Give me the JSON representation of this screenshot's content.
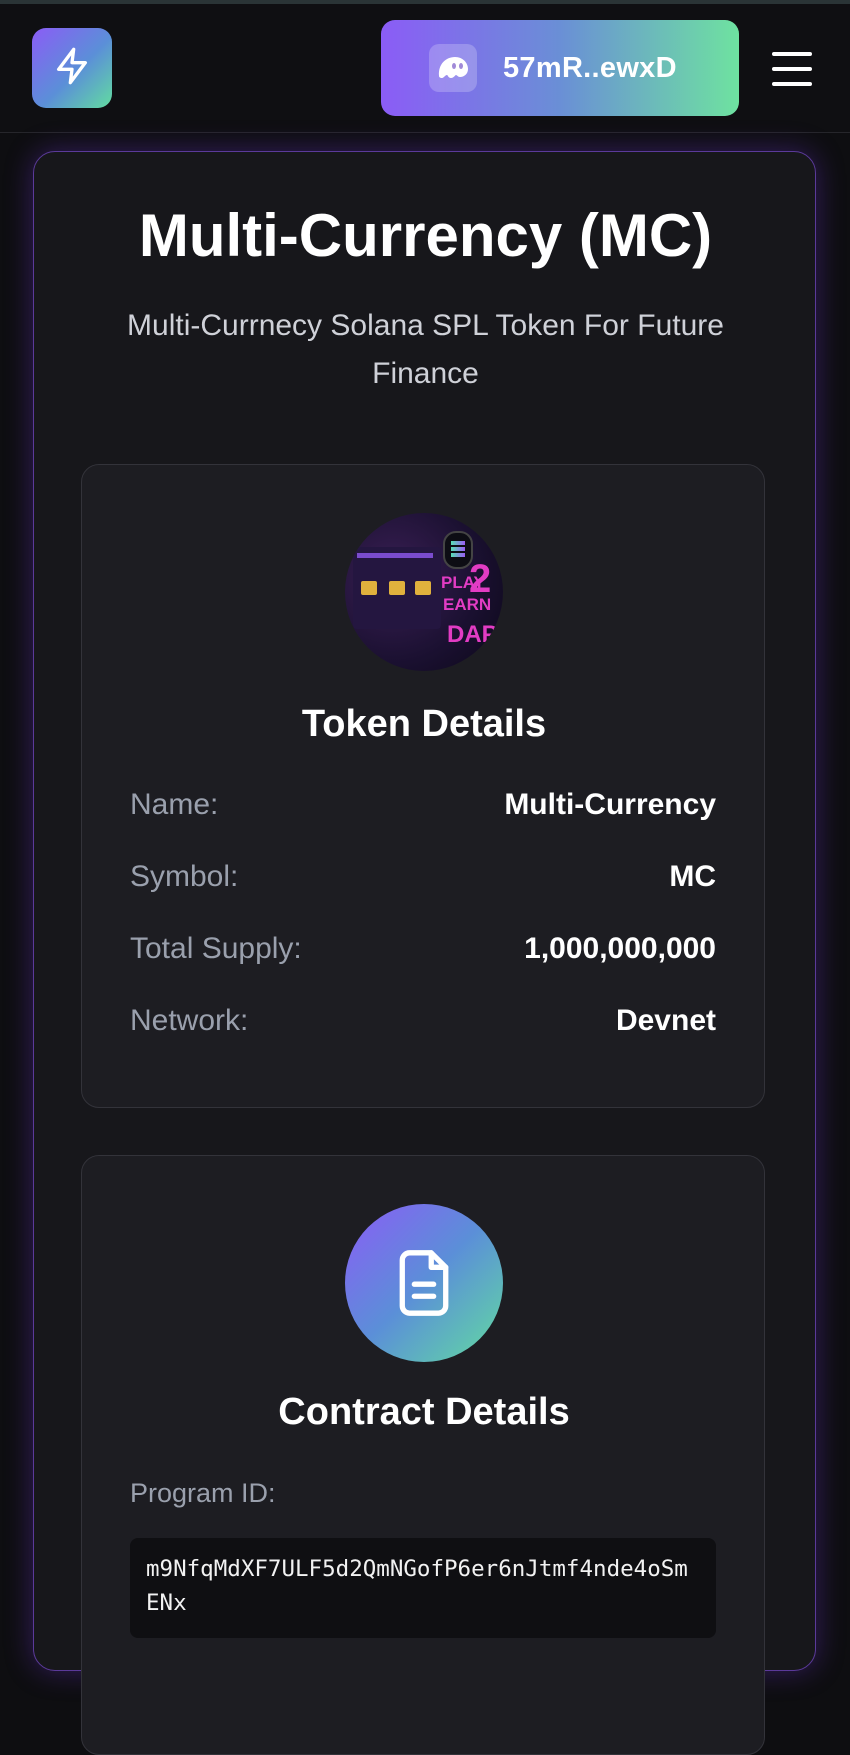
{
  "header": {
    "logo_icon": "lightning-bolt-icon",
    "wallet": {
      "icon": "phantom-ghost-icon",
      "label": "57mR..ewxD"
    },
    "menu_icon": "hamburger-menu-icon"
  },
  "hero": {
    "title": "Multi-Currency (MC)",
    "subtitle": "Multi-Currnecy Solana SPL Token For Future Finance"
  },
  "token_details": {
    "image_text": {
      "play": "PLAY",
      "two": "2",
      "earn": "EARN",
      "dapp": "DAPP"
    },
    "title": "Token Details",
    "rows": [
      {
        "label": "Name:",
        "value": "Multi-Currency"
      },
      {
        "label": "Symbol:",
        "value": "MC"
      },
      {
        "label": "Total Supply:",
        "value": "1,000,000,000"
      },
      {
        "label": "Network:",
        "value": "Devnet"
      }
    ]
  },
  "contract_details": {
    "icon": "document-icon",
    "title": "Contract Details",
    "program_id_label": "Program ID:",
    "program_id": "m9NfqMdXF7ULF5d2QmNGofP6er6nJtmf4nde4oSmENx"
  },
  "colors": {
    "accent_purple": "#8b5cf6",
    "accent_green": "#6ee2a0",
    "background": "#0e0e11",
    "card_border": "#5b3a9a"
  }
}
